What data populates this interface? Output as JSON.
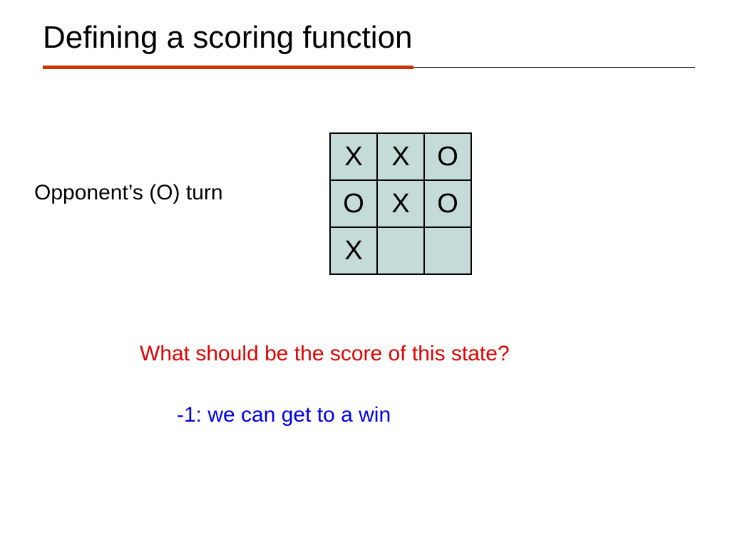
{
  "title": "Defining a scoring function",
  "turn_label": "Opponent’s (O) turn",
  "board": {
    "rows": [
      [
        "X",
        "X",
        "O"
      ],
      [
        "O",
        "X",
        "O"
      ],
      [
        "X",
        "",
        ""
      ]
    ]
  },
  "question": "What should be the score of this state?",
  "answer": "-1: we can get to a win",
  "colors": {
    "accent_rule": "#cc3300",
    "board_fill": "#c4dbd7",
    "question_text": "#e40000",
    "answer_text": "#0000ee"
  }
}
